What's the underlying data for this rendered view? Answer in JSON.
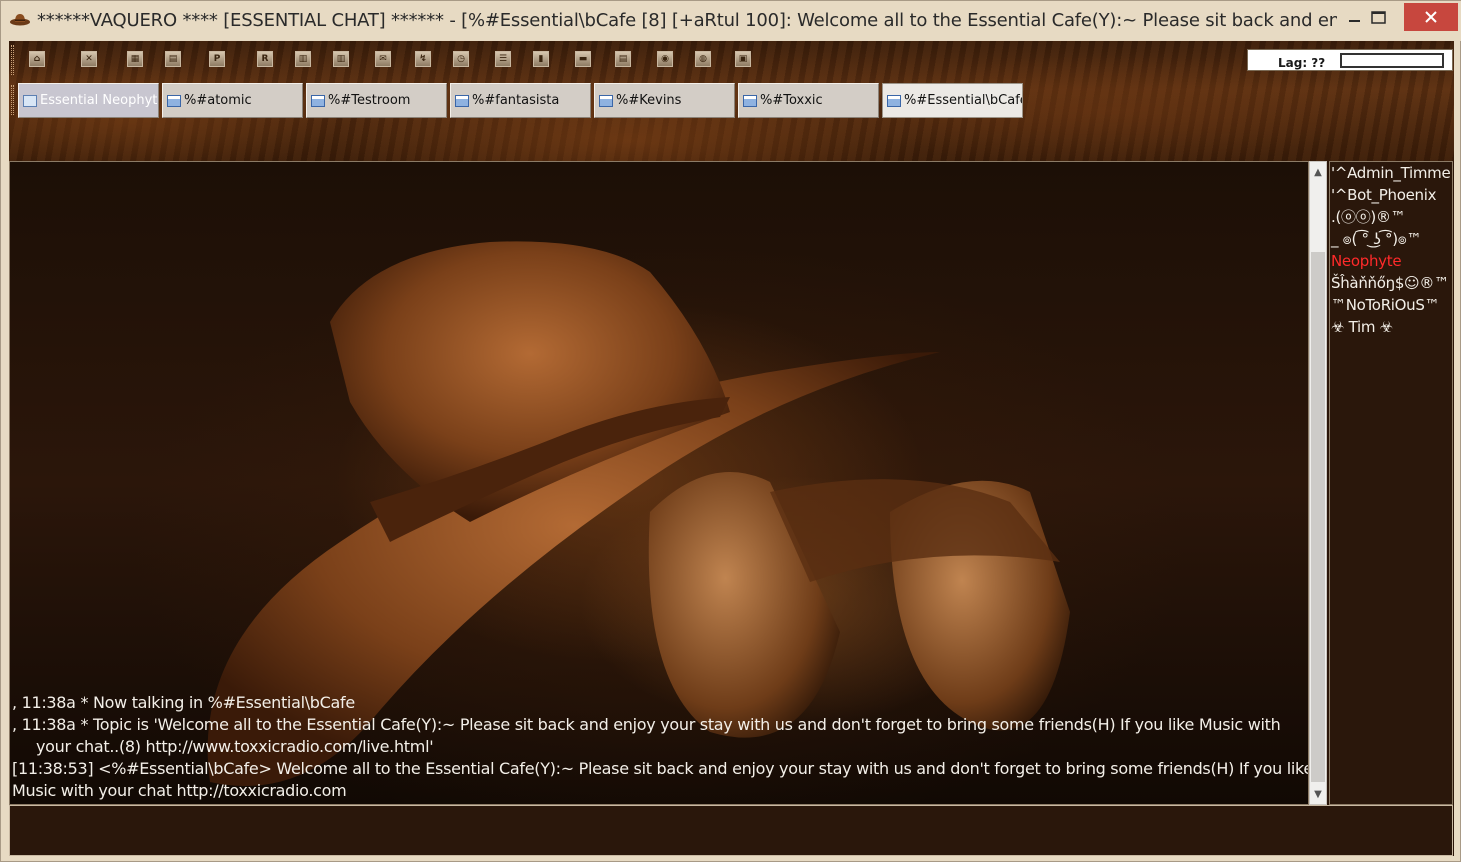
{
  "window": {
    "title": "******VAQUERO **** [ESSENTIAL CHAT] ****** - [%#Essential\\bCafe [8] [+aRtul 100]: Welcome all to the Essential Cafe(Y):~ Please sit back and enjoy you...",
    "minimize_icon": "minimize-icon",
    "maximize_icon": "maximize-icon",
    "close_icon": "close-icon",
    "close_color": "#c7473e"
  },
  "toolbar": {
    "buttons": [
      "connect-icon",
      "disconnect-icon",
      "options-icon",
      "address-book-icon",
      "dcc-chat-icon",
      "received-files-icon",
      "channel-list-icon",
      "channels-folder-icon",
      "scripts-editor-icon",
      "dcc-send-icon",
      "timer-icon",
      "notify-list-icon",
      "url-list-icon",
      "log-icon",
      "notes-icon",
      "online-status-icon",
      "dcc-options-icon",
      "about-icon"
    ],
    "lag_label": "Lag: ??"
  },
  "tabs": [
    {
      "label": "Essential Neophyte",
      "state": "status"
    },
    {
      "label": "%#atomic",
      "state": "normal"
    },
    {
      "label": "%#Testroom",
      "state": "normal"
    },
    {
      "label": "%#fantasista",
      "state": "normal"
    },
    {
      "label": "%#Kevins",
      "state": "normal"
    },
    {
      "label": "%#Toxxic",
      "state": "normal"
    },
    {
      "label": "%#Essential\\bCafe",
      "state": "active"
    }
  ],
  "chat": {
    "lines": [
      ",  11:38a    * Now talking in %#Essential\\bCafe",
      ",  11:38a    * Topic is 'Welcome all to the Essential Cafe(Y):~ Please sit back and enjoy your stay with us and don't forget to bring some friends(H) If you like Music with",
      "your chat..(8) http://www.toxxicradio.com/live.html'",
      "[11:38:53] <%#Essential\\bCafe> Welcome all to the Essential Cafe(Y):~ Please sit back and enjoy your stay with us and don't forget to bring some friends(H) If you like",
      "Music with your chat http://toxxicradio.com"
    ]
  },
  "nicklist": {
    "nicks": [
      {
        "label": "'^Admin_Timme",
        "color": "#f3efe8"
      },
      {
        "label": "'^Bot_Phoenix",
        "color": "#f3efe8"
      },
      {
        "label": ".(ⓞⓞ)®™",
        "color": "#f3efe8"
      },
      {
        "label": "_   ๏( ͡° ͜ʖ ͡°)๏™",
        "color": "#f3efe8"
      },
      {
        "label": "Neophyte",
        "color": "#ff2a2a"
      },
      {
        "label": "Šĥàňňőŋ$☺®™",
        "color": "#f3efe8"
      },
      {
        "label": "™NoToRiOuS™",
        "color": "#f3efe8"
      },
      {
        "label": "☣    Tim    ☣",
        "color": "#f3efe8"
      }
    ]
  },
  "editbox": {
    "value": ""
  }
}
